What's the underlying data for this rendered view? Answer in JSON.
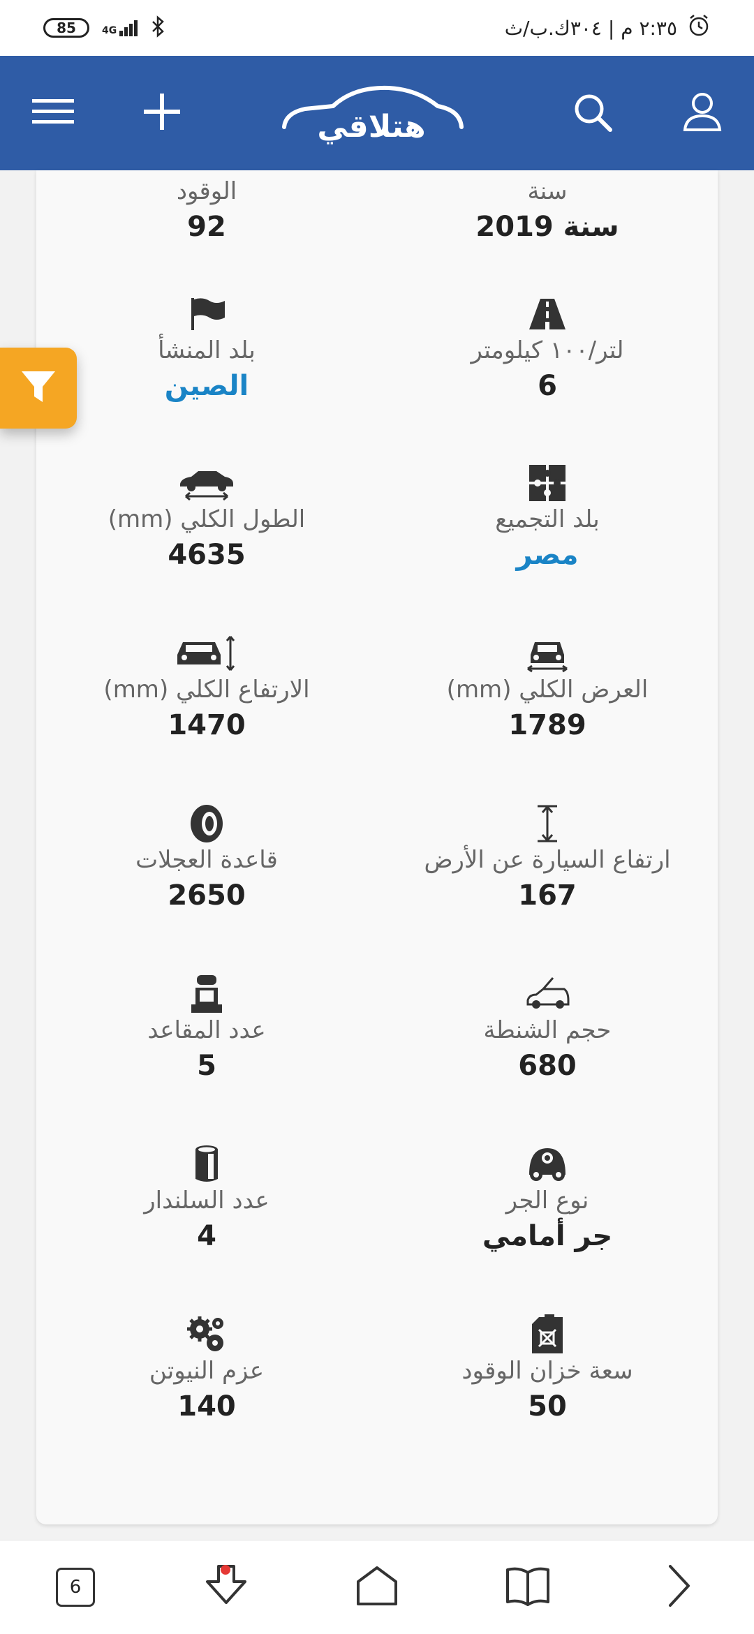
{
  "status_bar": {
    "battery": "85",
    "network": "4G",
    "time": "٢:٣٥ م | ٣٠٤ك.ب/ث"
  },
  "header": {
    "logo_text": "هتلاقي",
    "icons": [
      "menu-icon",
      "add-icon",
      "search-icon",
      "user-icon"
    ]
  },
  "specs": [
    {
      "label": "سنة",
      "value": "سنة 2019",
      "icon": "",
      "link": false
    },
    {
      "label": "الوقود",
      "value": "92",
      "icon": "",
      "link": false
    },
    {
      "label": "لتر/١٠٠ كيلومتر",
      "value": "6",
      "icon": "road-icon",
      "link": false
    },
    {
      "label": "بلد المنشأ",
      "value": "الصين",
      "icon": "flag-icon",
      "link": true
    },
    {
      "label": "بلد التجميع",
      "value": "مصر",
      "icon": "puzzle-icon",
      "link": true
    },
    {
      "label": "الطول الكلي (mm)",
      "value": "4635",
      "icon": "car-length-icon",
      "link": false
    },
    {
      "label": "العرض الكلي (mm)",
      "value": "1789",
      "icon": "car-width-icon",
      "link": false
    },
    {
      "label": "الارتفاع الكلي (mm)",
      "value": "1470",
      "icon": "car-height-icon",
      "link": false
    },
    {
      "label": "ارتفاع السيارة عن الأرض",
      "value": "167",
      "icon": "ground-clearance-icon",
      "link": false
    },
    {
      "label": "قاعدة العجلات",
      "value": "2650",
      "icon": "tire-icon",
      "link": false
    },
    {
      "label": "حجم الشنطة",
      "value": "680",
      "icon": "trunk-icon",
      "link": false
    },
    {
      "label": "عدد المقاعد",
      "value": "5",
      "icon": "seat-icon",
      "link": false
    },
    {
      "label": "نوع الجر",
      "value": "جر أمامي",
      "icon": "drivetrain-icon",
      "link": false
    },
    {
      "label": "عدد السلندار",
      "value": "4",
      "icon": "cylinder-icon",
      "link": false
    },
    {
      "label": "سعة خزان الوقود",
      "value": "50",
      "icon": "fuel-can-icon",
      "link": false
    },
    {
      "label": "عزم النيوتن",
      "value": "140",
      "icon": "gears-icon",
      "link": false
    }
  ],
  "filter_button": {
    "icon": "filter-icon"
  },
  "bottom_nav": {
    "tab_count": "6",
    "icons": [
      "tabs-icon",
      "download-icon",
      "home-icon",
      "bookmarks-icon",
      "forward-icon"
    ]
  },
  "colors": {
    "header_bg": "#2f5ca6",
    "accent_link": "#1a84c6",
    "filter_button": "#f5a623"
  }
}
